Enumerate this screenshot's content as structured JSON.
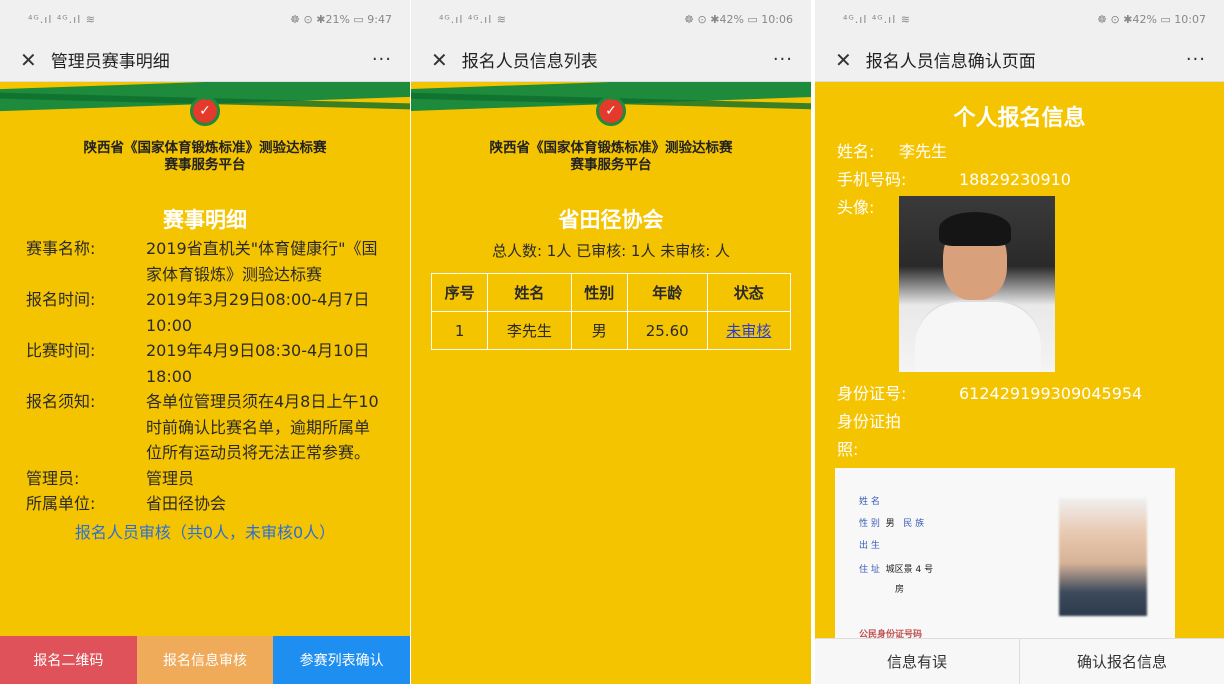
{
  "screen1": {
    "status": {
      "signal": "⁴ᴳ.ıl ⁴ᴳ.ıl ≋",
      "right": "☸ ⊙ ✱21% ▭ 9:47"
    },
    "nav_title": "管理员赛事明细",
    "more": "···",
    "close": "✕",
    "org_line1": "陕西省《国家体育锻炼标准》测验达标赛",
    "org_line2": "赛事服务平台",
    "section_title": "赛事明细",
    "rows": [
      {
        "k": "赛事名称:",
        "v": "2019省直机关\"体育健康行\"《国家体育锻炼》测验达标赛"
      },
      {
        "k": "报名时间:",
        "v": "2019年3月29日08:00-4月7日10:00"
      },
      {
        "k": "比赛时间:",
        "v": "2019年4月9日08:30-4月10日18:00"
      },
      {
        "k": "报名须知:",
        "v": "各单位管理员须在4月8日上午10时前确认比赛名单，逾期所属单位所有运动员将无法正常参赛。"
      },
      {
        "k": "管理员:",
        "v": "管理员"
      },
      {
        "k": "所属单位:",
        "v": "省田径协会"
      }
    ],
    "audit_link": "报名人员审核（共0人，未审核0人）",
    "buttons": [
      "报名二维码",
      "报名信息审核",
      "参赛列表确认"
    ]
  },
  "screen2": {
    "status": {
      "signal": "⁴ᴳ.ıl ⁴ᴳ.ıl ≋",
      "right": "☸ ⊙ ✱42% ▭ 10:06"
    },
    "nav_title": "报名人员信息列表",
    "more": "···",
    "close": "✕",
    "org_line1": "陕西省《国家体育锻炼标准》测验达标赛",
    "org_line2": "赛事服务平台",
    "section_title": "省田径协会",
    "summary": "总人数: 1人 已审核: 1人 未审核: 人",
    "table": {
      "headers": [
        "序号",
        "姓名",
        "性别",
        "年龄",
        "状态"
      ],
      "rows": [
        [
          "1",
          "李先生",
          "男",
          "25.60",
          "未审核"
        ]
      ]
    }
  },
  "screen3": {
    "status": {
      "signal": "⁴ᴳ.ıl ⁴ᴳ.ıl ≋",
      "right": "☸ ⊙ ✱42% ▭ 10:07"
    },
    "nav_title": "报名人员信息确认页面",
    "more": "···",
    "close": "✕",
    "heading": "个人报名信息",
    "name_label": "姓名:",
    "name_value": "李先生",
    "phone_label": "手机号码:",
    "phone_value": "18829230910",
    "avatar_label": "头像:",
    "id_label": "身份证号:",
    "id_value": "612429199309045954",
    "id_photo_label_1": "身份证拍",
    "id_photo_label_2": "照:",
    "idcard": {
      "name_label": "姓 名",
      "sex_label": "性 别",
      "sex_value": "男",
      "ethnic_label": "民 族",
      "birth_label": "出 生",
      "addr_label": "住 址",
      "addr_value": "城区景",
      "addr_value2": "4 号",
      "addr_value3": "房",
      "id_label": "公民身份证号码"
    },
    "buttons": [
      "信息有误",
      "确认报名信息"
    ]
  }
}
